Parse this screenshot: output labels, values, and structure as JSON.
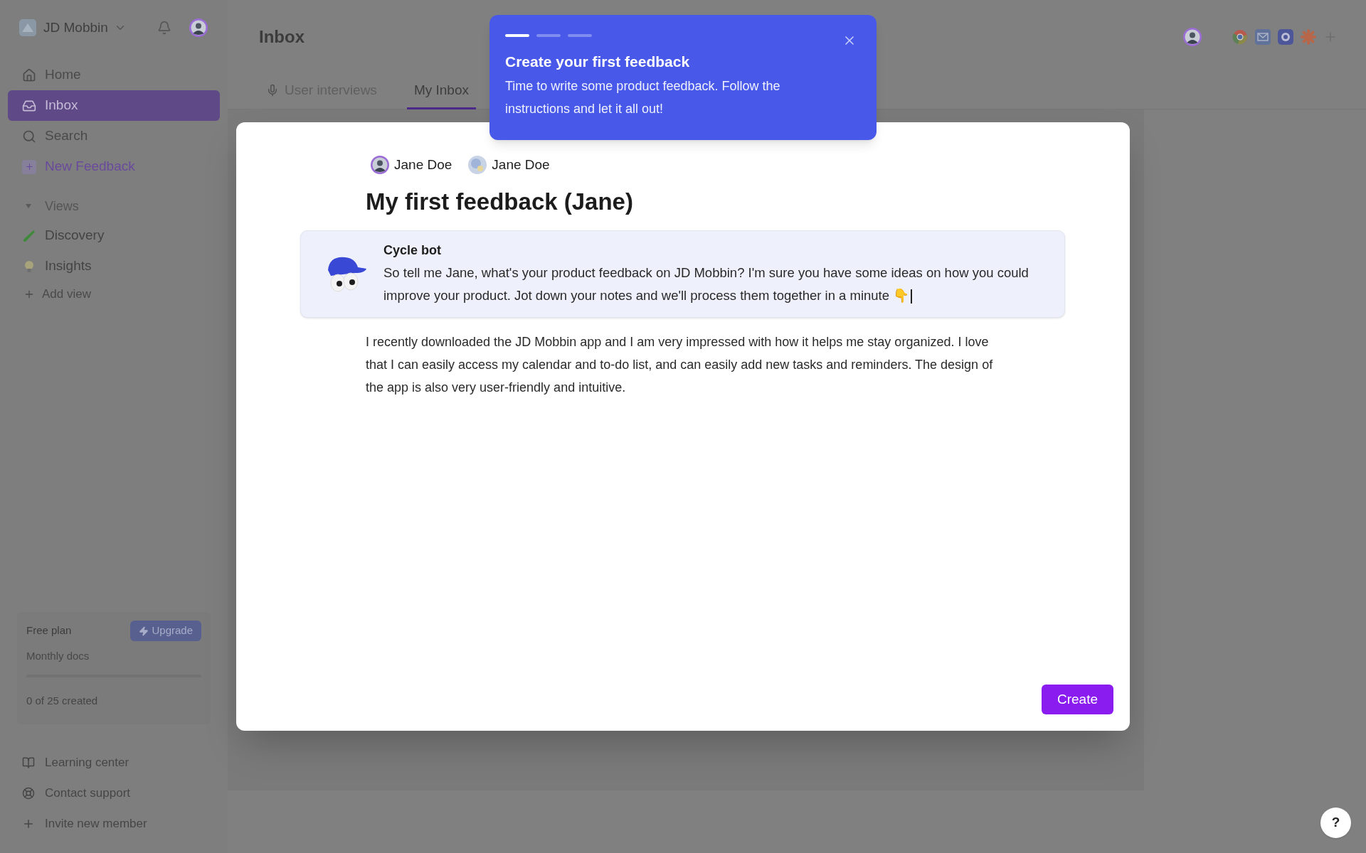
{
  "workspace": {
    "name": "JD Mobbin"
  },
  "sidebar": {
    "nav": [
      {
        "label": "Home",
        "selected": false
      },
      {
        "label": "Inbox",
        "selected": true
      },
      {
        "label": "Search",
        "selected": false
      },
      {
        "label": "New Feedback",
        "selected": false
      }
    ],
    "views_header": "Views",
    "views": [
      {
        "label": "Discovery"
      },
      {
        "label": "Insights"
      }
    ],
    "add_view": "Add view",
    "plan": {
      "name": "Free plan",
      "upgrade": "Upgrade",
      "docs_label": "Monthly docs",
      "level": 0,
      "count": "0 of 25 created"
    },
    "footer": [
      "Learning center",
      "Contact support",
      "Invite new member"
    ]
  },
  "page": {
    "title": "Inbox",
    "tabs": [
      {
        "label": "User interviews",
        "selected": false
      },
      {
        "label": "My Inbox",
        "selected": true
      }
    ]
  },
  "modal": {
    "assignees": [
      "Jane Doe",
      "Jane Doe"
    ],
    "title": "My first feedback (Jane)",
    "bot": {
      "name": "Cycle bot",
      "message": "So tell me Jane, what's your product feedback on JD Mobbin? I'm sure you have some ideas on how you could improve your product. Jot down your notes and we'll process them together in a minute 👇"
    },
    "body": "I recently downloaded the JD Mobbin app and I am very impressed with how it helps me stay organized. I love that I can easily access my calendar and to-do list, and can easily add new tasks and reminders. The design of the app is also very user-friendly and intuitive.",
    "create": "Create"
  },
  "tour": {
    "steps": [
      {
        "selected": true
      },
      {
        "selected": false
      },
      {
        "selected": false
      }
    ],
    "title": "Create your first feedback",
    "text": "Time to write some product feedback. Follow the instructions and let it all out!"
  },
  "help": "?"
}
